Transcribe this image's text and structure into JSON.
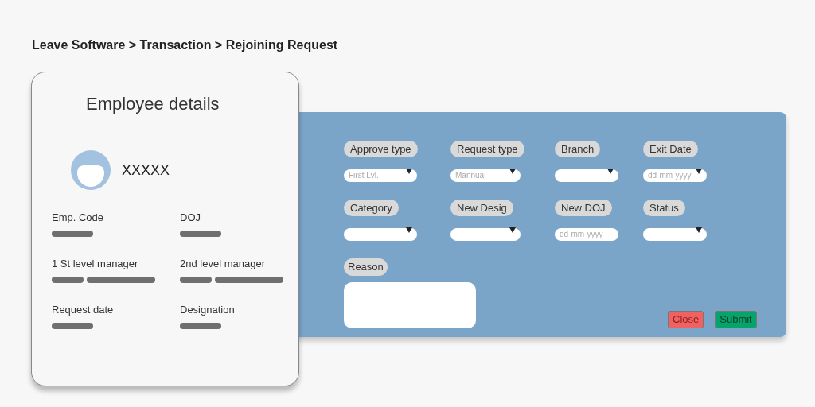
{
  "breadcrumb": "Leave Software > Transaction > Rejoining Request",
  "employee_card": {
    "title": "Employee details",
    "name": "XXXXX",
    "details": [
      {
        "label": "Emp. Code",
        "kind": "one-bar"
      },
      {
        "label": "DOJ",
        "kind": "one-bar"
      },
      {
        "label": "1 St level manager",
        "kind": "two-bars"
      },
      {
        "label": "2nd level manager",
        "kind": "two-bars"
      },
      {
        "label": "Request date",
        "kind": "one-bar"
      },
      {
        "label": "Designation",
        "kind": "one-bar"
      }
    ]
  },
  "form": {
    "fields": [
      {
        "label": "Approve type",
        "kind": "select",
        "placeholder": "First Lvl."
      },
      {
        "label": "Request type",
        "kind": "select",
        "placeholder": "Mannual"
      },
      {
        "label": "Branch",
        "kind": "select"
      },
      {
        "label": "Exit Date",
        "kind": "date-select",
        "placeholder": "dd-mm-yyyy"
      },
      {
        "label": "Category",
        "kind": "select"
      },
      {
        "label": "New Desig",
        "kind": "select"
      },
      {
        "label": "New DOJ",
        "kind": "date",
        "placeholder": "dd-mm-yyyy"
      },
      {
        "label": "Status",
        "kind": "select"
      }
    ],
    "reason": {
      "label": "Reason"
    },
    "buttons": [
      {
        "label": "Close",
        "kind": "close"
      },
      {
        "label": "Submit",
        "kind": "submit"
      }
    ]
  }
}
